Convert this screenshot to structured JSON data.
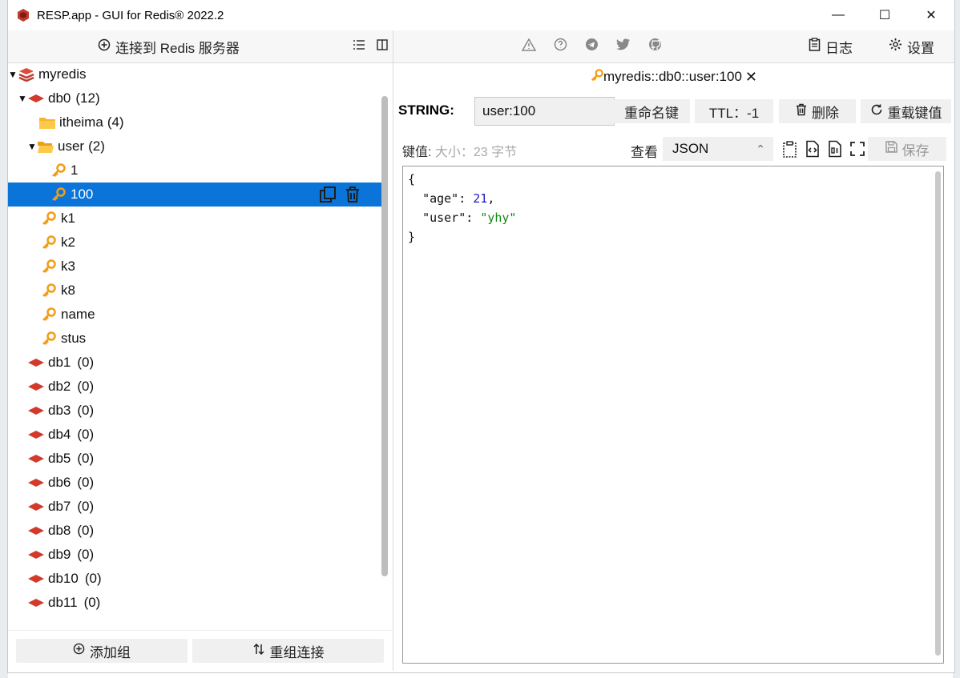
{
  "window": {
    "title": "RESP.app - GUI for Redis® 2022.2",
    "minimize": "—",
    "maximize": "☐",
    "close": "✕"
  },
  "left_toolbar": {
    "connect_label": "连接到 Redis 服务器"
  },
  "tree": {
    "server": "myredis",
    "db0": {
      "label": "db0",
      "count": "(12)"
    },
    "folders": [
      {
        "label": "itheima",
        "count": "(4)"
      },
      {
        "label": "user",
        "count": "(2)"
      }
    ],
    "user_keys": [
      "1",
      "100"
    ],
    "keys": [
      "k1",
      "k2",
      "k3",
      "k8",
      "name",
      "stus"
    ],
    "dbs": [
      {
        "label": "db1",
        "count": "(0)"
      },
      {
        "label": "db2",
        "count": "(0)"
      },
      {
        "label": "db3",
        "count": "(0)"
      },
      {
        "label": "db4",
        "count": "(0)"
      },
      {
        "label": "db5",
        "count": "(0)"
      },
      {
        "label": "db6",
        "count": "(0)"
      },
      {
        "label": "db7",
        "count": "(0)"
      },
      {
        "label": "db8",
        "count": "(0)"
      },
      {
        "label": "db9",
        "count": "(0)"
      },
      {
        "label": "db10",
        "count": "(0)"
      },
      {
        "label": "db11",
        "count": "(0)"
      }
    ]
  },
  "left_bottom": {
    "add_group": "添加组",
    "regroup": "重组连接"
  },
  "right_toolbar": {
    "log_label": "日志",
    "settings_label": "设置"
  },
  "tab": {
    "label": "myredis::db0::user:100"
  },
  "key_toolbar": {
    "type": "STRING:",
    "key_name": "user:100",
    "rename": "重命名键",
    "ttl": "TTL：-1",
    "delete": "删除",
    "reload": "重载键值"
  },
  "value_bar": {
    "label": "键值:",
    "size": "大小：23 字节",
    "view_label": "查看",
    "view_mode": "JSON",
    "save": "保存"
  },
  "editor": {
    "open": "{",
    "k1": "\"age\"",
    "v1": "21",
    "k2": "\"user\"",
    "v2": "\"yhy\"",
    "close": "}"
  },
  "colors": {
    "selection": "#0b74d9",
    "redis_red": "#d33a2c",
    "key_orange": "#f39c12",
    "folder_yellow": "#f7b32b"
  }
}
